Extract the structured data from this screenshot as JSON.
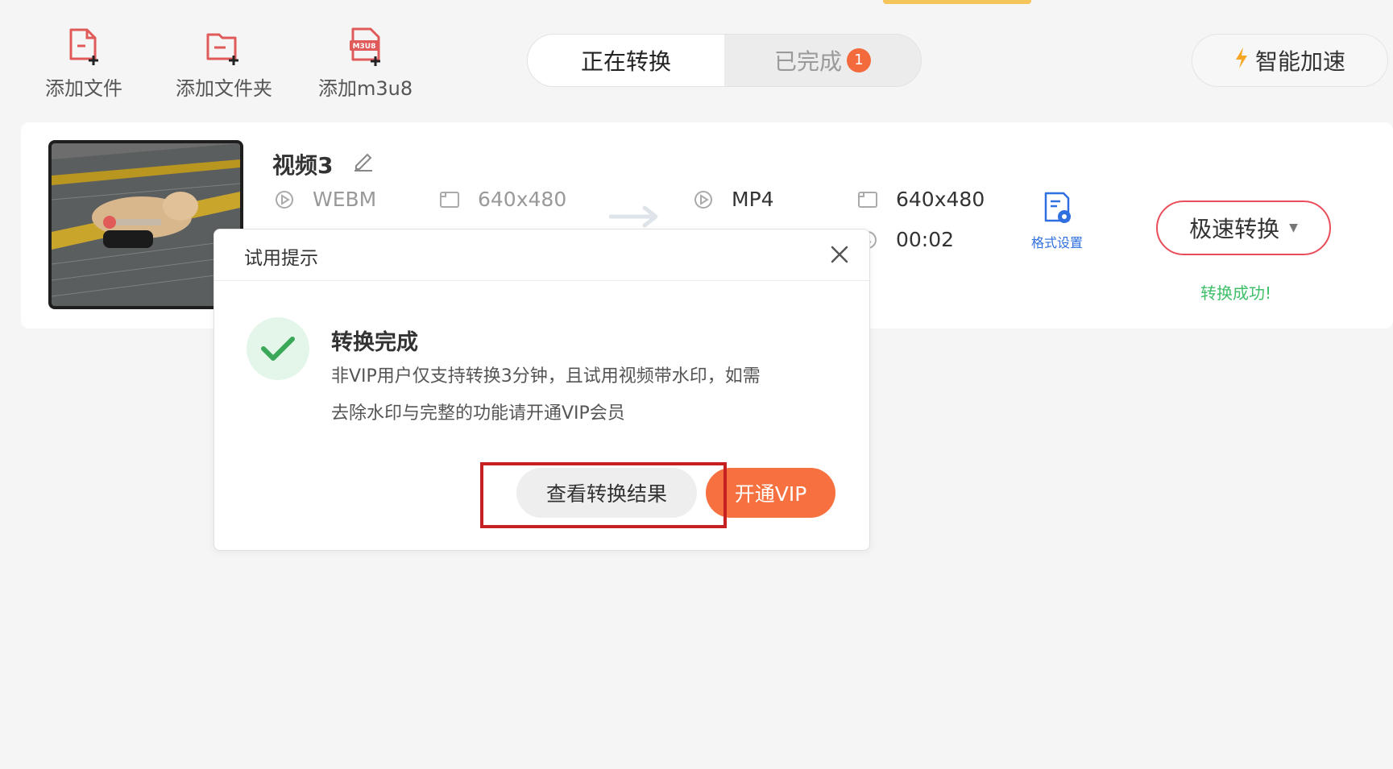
{
  "toolbar": {
    "add_file": "添加文件",
    "add_folder": "添加文件夹",
    "add_m3u8": "添加m3u8",
    "m3u8_icon_text": "M3U8"
  },
  "tabs": {
    "converting": "正在转换",
    "completed": "已完成",
    "completed_count": "1"
  },
  "speed_boost": "智能加速",
  "task": {
    "name": "视频3",
    "src_format": "WEBM",
    "src_resolution": "640x480",
    "dst_format": "MP4",
    "dst_resolution": "640x480",
    "duration": "00:02",
    "format_settings": "格式设置",
    "convert_mode": "极速转换",
    "status": "转换成功!"
  },
  "dialog": {
    "title": "试用提示",
    "heading": "转换完成",
    "message_line1": "非VIP用户仅支持转换3分钟，且试用视频带水印，如需",
    "message_line2": "去除水印与完整的功能请开通VIP会员",
    "view_result": "查看转换结果",
    "open_vip": "开通VIP"
  },
  "colors": {
    "accent_red": "#e94d5a",
    "vip_orange": "#f7703f",
    "success_green": "#3fbf6a",
    "link_blue": "#2f6fe0",
    "highlight_box": "#c72020"
  },
  "icons": {
    "add_file": "file-plus-icon",
    "add_folder": "folder-plus-icon",
    "add_m3u8": "m3u8-plus-icon",
    "speed": "lightning-icon",
    "edit": "pencil-icon",
    "format": "video-format-icon",
    "resolution": "resolution-icon",
    "duration": "clock-icon",
    "settings": "format-settings-icon",
    "close": "close-icon",
    "success": "check-icon"
  }
}
